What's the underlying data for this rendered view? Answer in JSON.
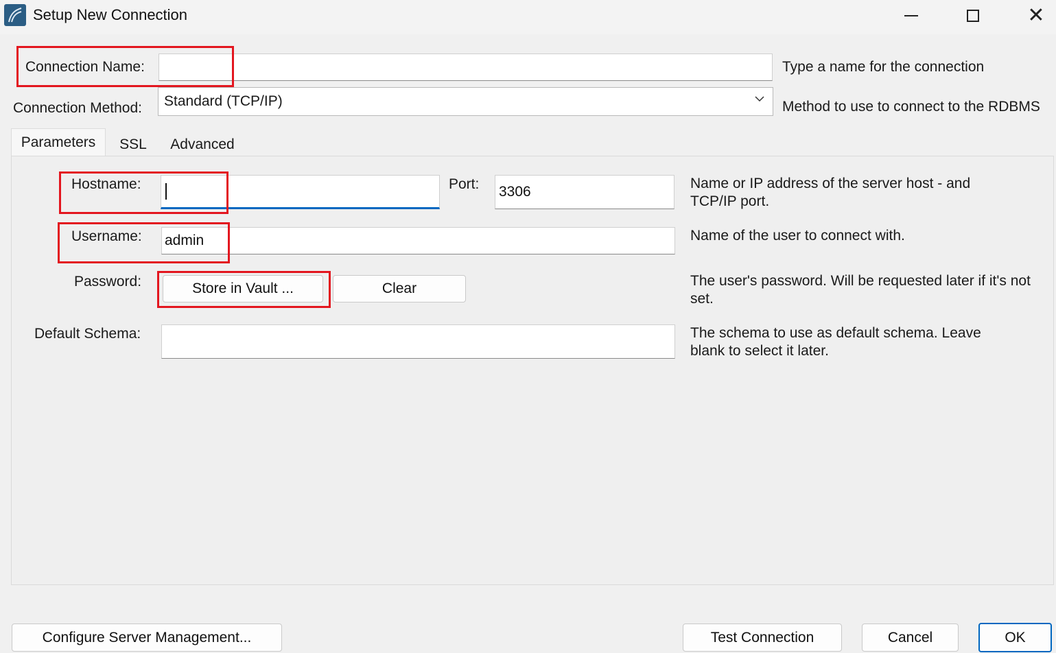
{
  "window": {
    "title": "Setup New Connection",
    "icon": "mysql-workbench-icon"
  },
  "connection_name": {
    "label": "Connection Name:",
    "value": "",
    "hint": "Type a name for the connection"
  },
  "connection_method": {
    "label": "Connection Method:",
    "selected": "Standard (TCP/IP)",
    "hint": "Method to use to connect to the RDBMS"
  },
  "tabs": [
    {
      "label": "Parameters",
      "active": true
    },
    {
      "label": "SSL",
      "active": false
    },
    {
      "label": "Advanced",
      "active": false
    }
  ],
  "parameters": {
    "hostname": {
      "label": "Hostname:",
      "value": ""
    },
    "port": {
      "label": "Port:",
      "value": "3306"
    },
    "hostname_hint": "Name or IP address of the server host - and TCP/IP port.",
    "username": {
      "label": "Username:",
      "value": "admin",
      "hint": "Name of the user to connect with."
    },
    "password": {
      "label": "Password:",
      "store_button": "Store in Vault ...",
      "clear_button": "Clear",
      "hint": "The user's password. Will be requested later if it's not set."
    },
    "default_schema": {
      "label": "Default Schema:",
      "value": "",
      "hint": "The schema to use as default schema. Leave blank to select it later."
    }
  },
  "footer": {
    "configure_button": "Configure Server Management...",
    "test_button": "Test Connection",
    "cancel_button": "Cancel",
    "ok_button": "OK"
  },
  "colors": {
    "highlight": "#e3161f",
    "focus": "#0067c0",
    "background": "#f0f0f0"
  }
}
